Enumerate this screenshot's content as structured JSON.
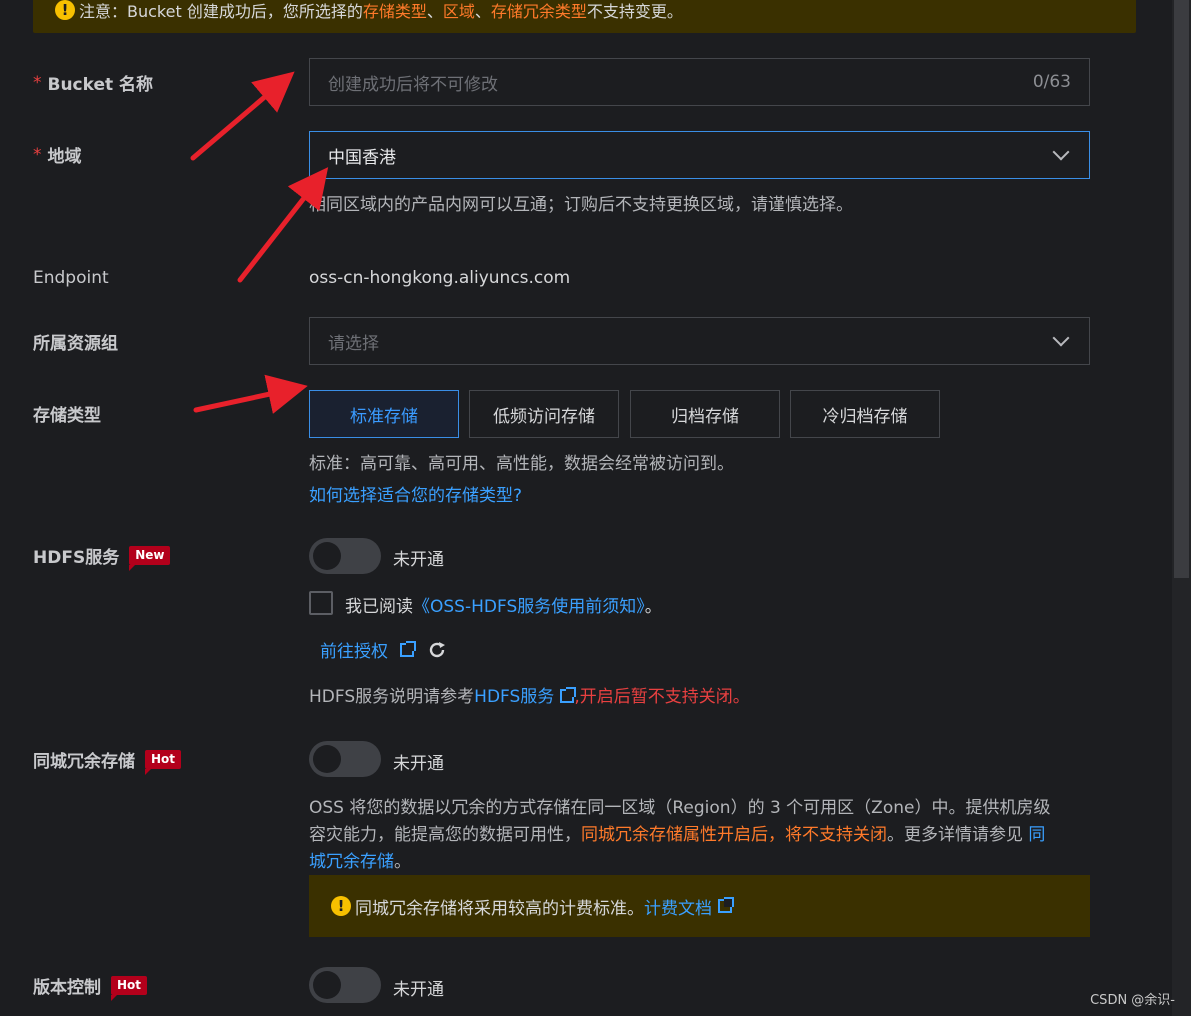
{
  "notice": {
    "prefix": "注意：Bucket 创建成功后，您所选择的 ",
    "highlight1": "存储类型",
    "sep1": "、",
    "highlight2": "区域",
    "sep2": "、",
    "highlight3": "存储冗余类型",
    "suffix": " 不支持变更。"
  },
  "bucket_name": {
    "label": "Bucket 名称",
    "placeholder": "创建成功后将不可修改",
    "counter": "0/63"
  },
  "region": {
    "label": "地域",
    "value": "中国香港",
    "hint": "相同区域内的产品内网可以互通；订购后不支持更换区域，请谨慎选择。"
  },
  "endpoint": {
    "label": "Endpoint",
    "value": "oss-cn-hongkong.aliyuncs.com"
  },
  "resource_group": {
    "label": "所属资源组",
    "placeholder": "请选择"
  },
  "storage_type": {
    "label": "存储类型",
    "options": [
      "标准存储",
      "低频访问存储",
      "归档存储",
      "冷归档存储"
    ],
    "selected": "标准存储",
    "desc": "标准：高可靠、高可用、高性能，数据会经常被访问到。",
    "help_link": "如何选择适合您的存储类型?"
  },
  "hdfs": {
    "label": "HDFS服务",
    "tag": "New",
    "toggle_label": "未开通",
    "agree_prefix": "我已阅读",
    "agree_link": "《OSS-HDFS服务使用前须知》",
    "agree_suffix": "。",
    "auth_link": "前往授权",
    "note_prefix": "HDFS服务说明请参考",
    "note_link": "HDFS服务",
    "note_warn": ",开启后暂不支持关闭。"
  },
  "zrs": {
    "label": "同城冗余存储",
    "tag": "Hot",
    "toggle_label": "未开通",
    "desc_line1": "OSS 将您的数据以冗余的方式存储在同一区域（Region）的 3 个可用区（Zone）中。提供机房级",
    "desc_line2_a": "容灾能力，能提高您的数据可用性，",
    "desc_line2_warn": "同城冗余存储属性开启后，将不支持关闭",
    "desc_line2_b": "。更多详情请参见 ",
    "desc_link1": "同",
    "desc_link2": "城冗余存储",
    "desc_line3_end": "。",
    "warn_text": "同城冗余存储将采用较高的计费标准。",
    "warn_link": "计费文档"
  },
  "versioning": {
    "label": "版本控制",
    "tag": "Hot",
    "toggle_label": "未开通"
  },
  "watermark": "CSDN @余识-",
  "colors": {
    "accent": "#3a8ee6",
    "link": "#3aa0ff",
    "warning_bg": "#3a3000",
    "danger": "#e84040",
    "orange": "#ff7a2a",
    "arrow": "#e8212b"
  }
}
